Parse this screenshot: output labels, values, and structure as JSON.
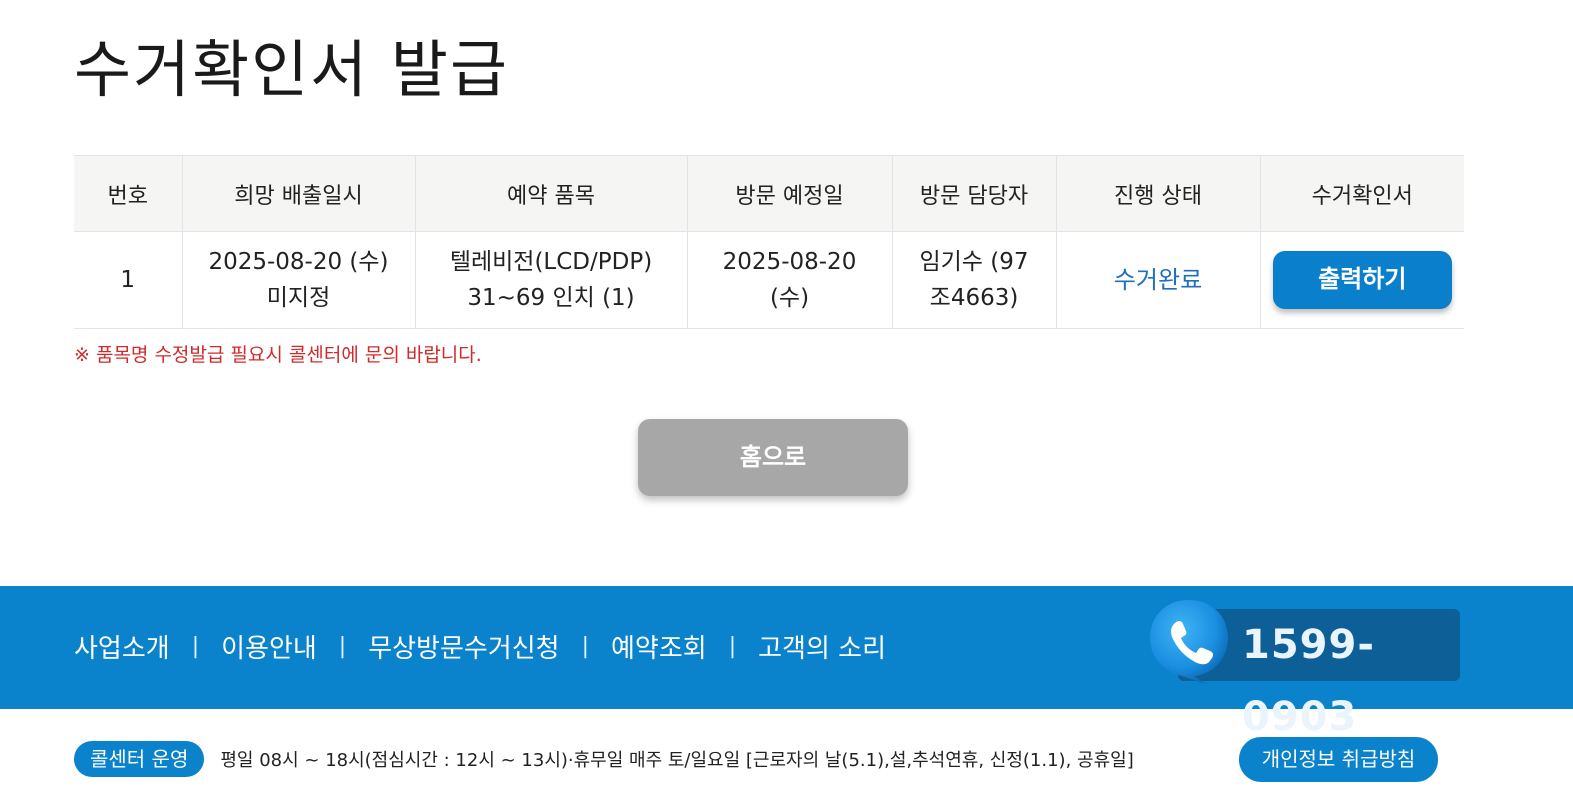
{
  "page": {
    "title": "수거확인서 발급"
  },
  "table": {
    "headers": [
      "번호",
      "희망 배출일시",
      "예약 품목",
      "방문 예정일",
      "방문 담당자",
      "진행 상태",
      "수거확인서"
    ],
    "rows": [
      {
        "no": "1",
        "date_line1": "2025-08-20 (수)",
        "date_line2": "미지정",
        "item_line1": "텔레비전(LCD/PDP)",
        "item_line2": "31~69 인치 (1)",
        "visit_line1": "2025-08-20",
        "visit_line2": "(수)",
        "staff_line1": "임기수 (97",
        "staff_line2": "조4663)",
        "status": "수거완료",
        "print_label": "출력하기"
      }
    ]
  },
  "notice": "※ 품목명 수정발급 필요시 콜센터에 문의 바랍니다.",
  "home_button": "홈으로",
  "footer": {
    "nav": [
      "사업소개",
      "이용안내",
      "무상방문수거신청",
      "예약조회",
      "고객의 소리"
    ],
    "separator": "|",
    "phone": "1599-0903",
    "callcenter_badge": "콜센터 운영",
    "callcenter_hours": "평일 08시 ~ 18시(점심시간 : 12시 ~ 13시)·휴무일 매주 토/일요일    [근로자의 날(5.1),설,추석연휴, 신정(1.1), 공휴일]",
    "privacy_button": "개인정보 취급방침"
  },
  "colors": {
    "primary": "#0a82cc",
    "status_text": "#1f6fbf",
    "notice": "#d02a2a",
    "home_button": "#a7a7a7"
  },
  "icons": {
    "phone": "phone-call-icon"
  }
}
